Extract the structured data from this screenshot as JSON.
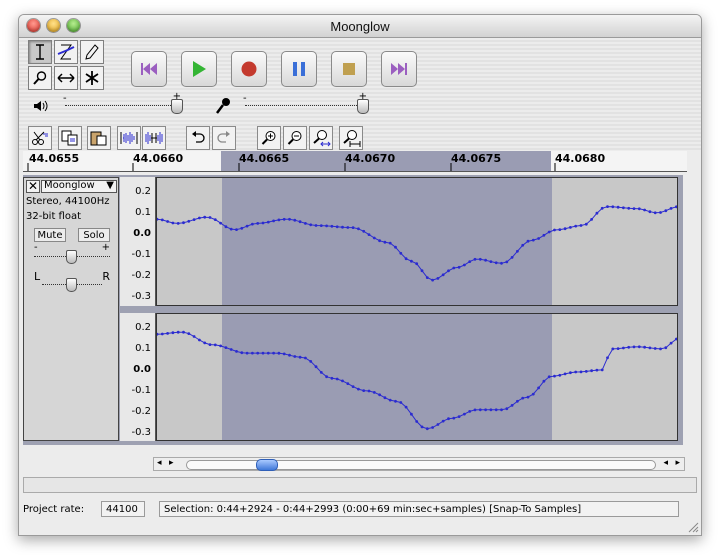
{
  "window": {
    "title": "Moonglow"
  },
  "tools": {
    "selection": "selection-tool",
    "envelope": "envelope-tool",
    "draw": "draw-tool",
    "zoom": "zoom-tool",
    "timeshift": "time-shift-tool",
    "multi": "multi-tool"
  },
  "transport": {
    "skip_start": "skip-to-start",
    "play": "play",
    "record": "record",
    "pause": "pause",
    "stop": "stop",
    "skip_end": "skip-to-end"
  },
  "meters": {
    "output_icon": "speaker-icon",
    "input_icon": "microphone-icon"
  },
  "ruler": {
    "labels": [
      "44.0655",
      "44.0660",
      "44.0665",
      "44.0670",
      "44.0675",
      "44.0680"
    ]
  },
  "track": {
    "name": "Moonglow",
    "info_line1": "Stereo, 44100Hz",
    "info_line2": "32-bit float",
    "mute_label": "Mute",
    "solo_label": "Solo",
    "gain_minus": "-",
    "gain_plus": "+",
    "pan_left": "L",
    "pan_right": "R",
    "y_ticks": [
      "0.2",
      "0.1",
      "0.0",
      "-0.1",
      "-0.2",
      "-0.3"
    ],
    "waveform_color": "#2b2bd0",
    "selection_color": "#9a9cb3",
    "background_color": "#c8c8c8"
  },
  "statusbar": {
    "project_rate_label": "Project rate:",
    "project_rate_value": "44100",
    "selection_text": "Selection: 0:44+2924 - 0:44+2993 (0:00+69 min:sec+samples)   [Snap-To Samples]"
  }
}
